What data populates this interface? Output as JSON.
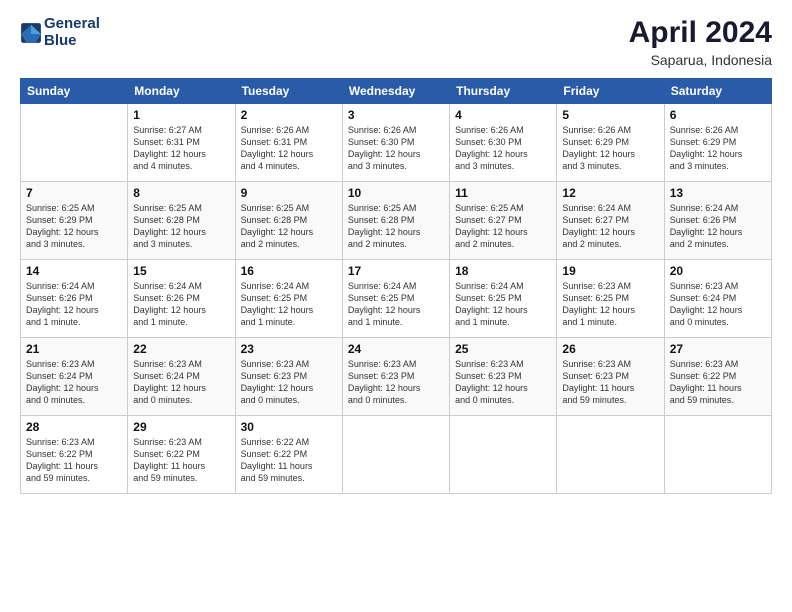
{
  "logo": {
    "line1": "General",
    "line2": "Blue"
  },
  "title": "April 2024",
  "subtitle": "Saparua, Indonesia",
  "days_of_week": [
    "Sunday",
    "Monday",
    "Tuesday",
    "Wednesday",
    "Thursday",
    "Friday",
    "Saturday"
  ],
  "weeks": [
    [
      {
        "day": "",
        "info": ""
      },
      {
        "day": "1",
        "info": "Sunrise: 6:27 AM\nSunset: 6:31 PM\nDaylight: 12 hours\nand 4 minutes."
      },
      {
        "day": "2",
        "info": "Sunrise: 6:26 AM\nSunset: 6:31 PM\nDaylight: 12 hours\nand 4 minutes."
      },
      {
        "day": "3",
        "info": "Sunrise: 6:26 AM\nSunset: 6:30 PM\nDaylight: 12 hours\nand 3 minutes."
      },
      {
        "day": "4",
        "info": "Sunrise: 6:26 AM\nSunset: 6:30 PM\nDaylight: 12 hours\nand 3 minutes."
      },
      {
        "day": "5",
        "info": "Sunrise: 6:26 AM\nSunset: 6:29 PM\nDaylight: 12 hours\nand 3 minutes."
      },
      {
        "day": "6",
        "info": "Sunrise: 6:26 AM\nSunset: 6:29 PM\nDaylight: 12 hours\nand 3 minutes."
      }
    ],
    [
      {
        "day": "7",
        "info": "Sunrise: 6:25 AM\nSunset: 6:29 PM\nDaylight: 12 hours\nand 3 minutes."
      },
      {
        "day": "8",
        "info": "Sunrise: 6:25 AM\nSunset: 6:28 PM\nDaylight: 12 hours\nand 3 minutes."
      },
      {
        "day": "9",
        "info": "Sunrise: 6:25 AM\nSunset: 6:28 PM\nDaylight: 12 hours\nand 2 minutes."
      },
      {
        "day": "10",
        "info": "Sunrise: 6:25 AM\nSunset: 6:28 PM\nDaylight: 12 hours\nand 2 minutes."
      },
      {
        "day": "11",
        "info": "Sunrise: 6:25 AM\nSunset: 6:27 PM\nDaylight: 12 hours\nand 2 minutes."
      },
      {
        "day": "12",
        "info": "Sunrise: 6:24 AM\nSunset: 6:27 PM\nDaylight: 12 hours\nand 2 minutes."
      },
      {
        "day": "13",
        "info": "Sunrise: 6:24 AM\nSunset: 6:26 PM\nDaylight: 12 hours\nand 2 minutes."
      }
    ],
    [
      {
        "day": "14",
        "info": "Sunrise: 6:24 AM\nSunset: 6:26 PM\nDaylight: 12 hours\nand 1 minute."
      },
      {
        "day": "15",
        "info": "Sunrise: 6:24 AM\nSunset: 6:26 PM\nDaylight: 12 hours\nand 1 minute."
      },
      {
        "day": "16",
        "info": "Sunrise: 6:24 AM\nSunset: 6:25 PM\nDaylight: 12 hours\nand 1 minute."
      },
      {
        "day": "17",
        "info": "Sunrise: 6:24 AM\nSunset: 6:25 PM\nDaylight: 12 hours\nand 1 minute."
      },
      {
        "day": "18",
        "info": "Sunrise: 6:24 AM\nSunset: 6:25 PM\nDaylight: 12 hours\nand 1 minute."
      },
      {
        "day": "19",
        "info": "Sunrise: 6:23 AM\nSunset: 6:25 PM\nDaylight: 12 hours\nand 1 minute."
      },
      {
        "day": "20",
        "info": "Sunrise: 6:23 AM\nSunset: 6:24 PM\nDaylight: 12 hours\nand 0 minutes."
      }
    ],
    [
      {
        "day": "21",
        "info": "Sunrise: 6:23 AM\nSunset: 6:24 PM\nDaylight: 12 hours\nand 0 minutes."
      },
      {
        "day": "22",
        "info": "Sunrise: 6:23 AM\nSunset: 6:24 PM\nDaylight: 12 hours\nand 0 minutes."
      },
      {
        "day": "23",
        "info": "Sunrise: 6:23 AM\nSunset: 6:23 PM\nDaylight: 12 hours\nand 0 minutes."
      },
      {
        "day": "24",
        "info": "Sunrise: 6:23 AM\nSunset: 6:23 PM\nDaylight: 12 hours\nand 0 minutes."
      },
      {
        "day": "25",
        "info": "Sunrise: 6:23 AM\nSunset: 6:23 PM\nDaylight: 12 hours\nand 0 minutes."
      },
      {
        "day": "26",
        "info": "Sunrise: 6:23 AM\nSunset: 6:23 PM\nDaylight: 11 hours\nand 59 minutes."
      },
      {
        "day": "27",
        "info": "Sunrise: 6:23 AM\nSunset: 6:22 PM\nDaylight: 11 hours\nand 59 minutes."
      }
    ],
    [
      {
        "day": "28",
        "info": "Sunrise: 6:23 AM\nSunset: 6:22 PM\nDaylight: 11 hours\nand 59 minutes."
      },
      {
        "day": "29",
        "info": "Sunrise: 6:23 AM\nSunset: 6:22 PM\nDaylight: 11 hours\nand 59 minutes."
      },
      {
        "day": "30",
        "info": "Sunrise: 6:22 AM\nSunset: 6:22 PM\nDaylight: 11 hours\nand 59 minutes."
      },
      {
        "day": "",
        "info": ""
      },
      {
        "day": "",
        "info": ""
      },
      {
        "day": "",
        "info": ""
      },
      {
        "day": "",
        "info": ""
      }
    ]
  ]
}
